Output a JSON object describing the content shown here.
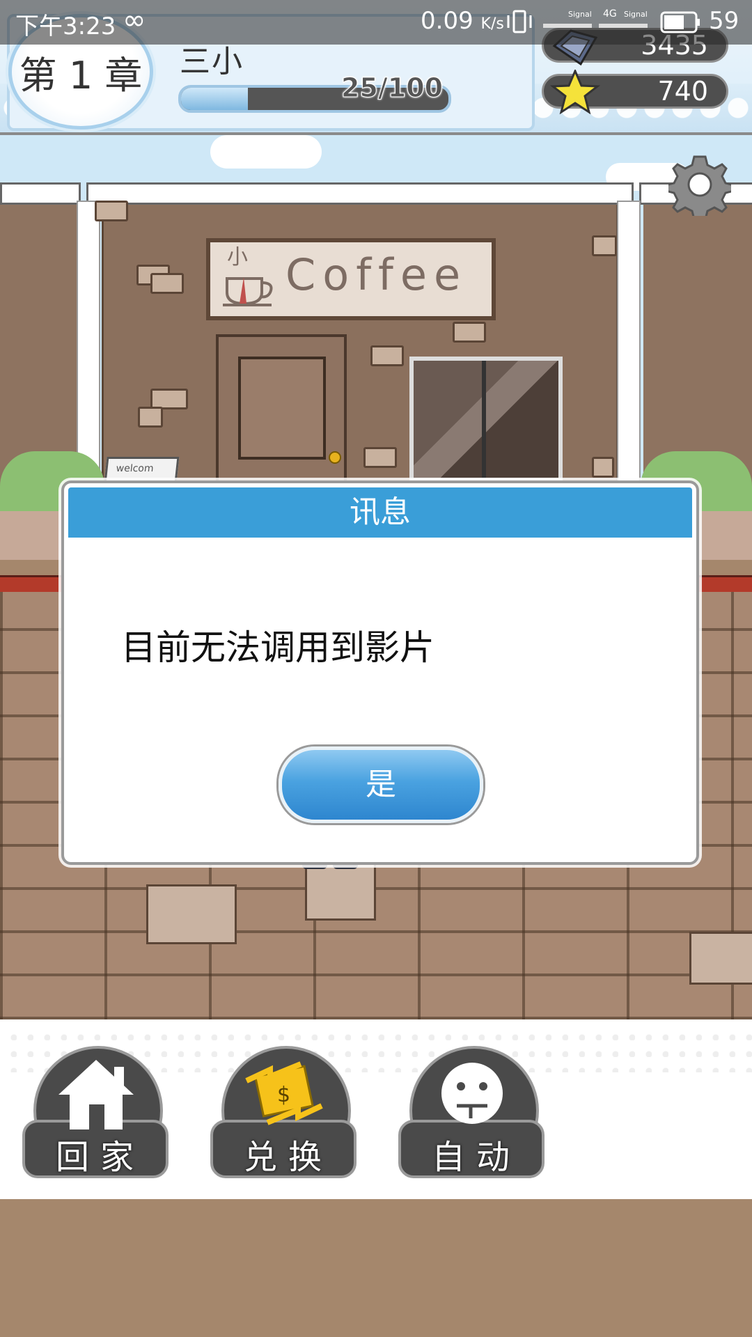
{
  "status_bar": {
    "time": "下午3:23",
    "loop_glyph": "∞",
    "net_speed": "0.09",
    "net_speed_unit": "K/s",
    "signal_label_1": "Signal",
    "network_type": "4G",
    "signal_label_2": "Signal",
    "battery": "59"
  },
  "hud": {
    "chapter": "第 1 章",
    "player_name": "三小",
    "exp_text": "25/100",
    "exp_fraction": 0.25,
    "gems": "3435",
    "stars": "740"
  },
  "scene": {
    "shop_sign": "Coffee",
    "sign_prefix": "小",
    "welcome_board": "welcom"
  },
  "dialog": {
    "title": "讯息",
    "message": "目前无法调用到影片",
    "confirm_label": "是"
  },
  "menu": {
    "home_label": "回家",
    "exchange_label": "兑换",
    "auto_label": "自动"
  },
  "colors": {
    "dialog_header": "#3a9ed8",
    "button_blue": "#4aa2e0",
    "menu_dark": "#4a4a4a",
    "ground": "#a88872"
  }
}
